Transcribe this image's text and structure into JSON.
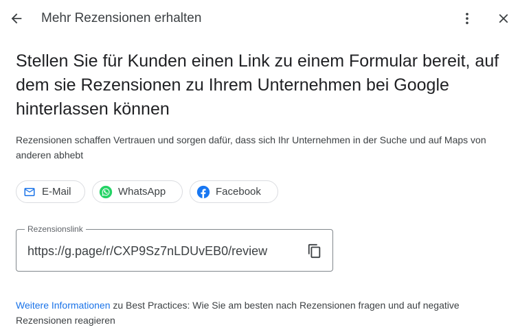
{
  "header": {
    "title": "Mehr Rezensionen erhalten",
    "back_icon": "arrow-back-icon",
    "more_icon": "more-vert-icon",
    "close_icon": "close-icon"
  },
  "main": {
    "heading": "Stellen Sie für Kunden einen Link zu einem Formular bereit, auf dem sie Rezensionen zu Ihrem Unternehmen bei Google hinterlassen können",
    "description": "Rezensionen schaffen Vertrauen und sorgen dafür, dass sich Ihr Unternehmen in der Suche und auf Maps von anderen abhebt"
  },
  "share": {
    "email": {
      "label": "E-Mail",
      "icon": "mail-icon",
      "color": "#1a73e8"
    },
    "whatsapp": {
      "label": "WhatsApp",
      "icon": "whatsapp-icon",
      "color": "#25d366"
    },
    "facebook": {
      "label": "Facebook",
      "icon": "facebook-icon",
      "color": "#1877f2"
    }
  },
  "review_link": {
    "label": "Rezensionslink",
    "value": "https://g.page/r/CXP9Sz7nLDUvEB0/review",
    "copy_icon": "copy-icon"
  },
  "footer": {
    "link_text": "Weitere Informationen",
    "text": " zu Best Practices: Wie Sie am besten nach Rezensionen fragen und auf negative Rezensionen reagieren",
    "link_color": "#1a73e8"
  }
}
